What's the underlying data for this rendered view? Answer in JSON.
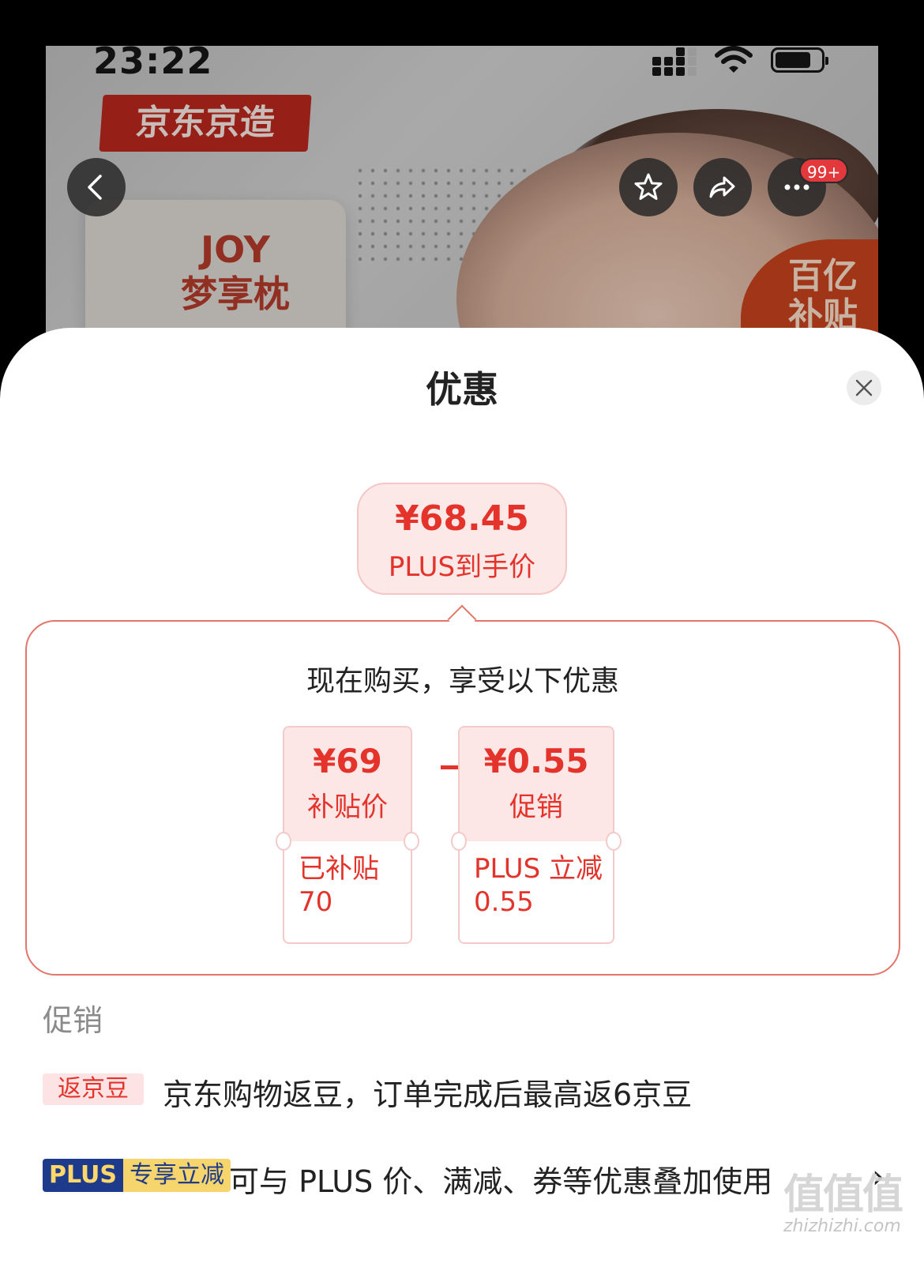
{
  "status_bar": {
    "time": "23:22"
  },
  "hero": {
    "brand_tag": "京东京造",
    "product_line1": "JOY",
    "product_line2": "梦享枕",
    "subsidy_line1": "百亿",
    "subsidy_line2": "补贴",
    "more_badge": "99+"
  },
  "sheet": {
    "title": "优惠",
    "final_price": "¥68.45",
    "final_label": "PLUS到手价",
    "calc_heading": "现在购买，享受以下优惠",
    "tickets": [
      {
        "amount": "¥69",
        "name": "补贴价",
        "detail_line1": "已补贴",
        "detail_line2": "70"
      },
      {
        "amount": "¥0.55",
        "name": "促销",
        "detail_line1": "PLUS 立减",
        "detail_line2": "0.55"
      }
    ],
    "section_label": "促销",
    "promos": [
      {
        "tag": "返京豆",
        "text": "京东购物返豆，订单完成后最高返6京豆"
      },
      {
        "tag_left": "PLUS",
        "tag_right": "专享立减",
        "text": "可与 PLUS 价、满减、券等优惠叠加使用",
        "chevron": "›"
      }
    ]
  },
  "watermark": {
    "main": "值值值",
    "sub": "zhizhizhi.com"
  },
  "colors": {
    "accent": "#e3332b",
    "plus_blue": "#1d3b8a",
    "plus_gold": "#f5d56c"
  },
  "icons": [
    "back-icon",
    "star-icon",
    "share-icon",
    "more-icon",
    "close-icon",
    "chevron-right-icon"
  ]
}
